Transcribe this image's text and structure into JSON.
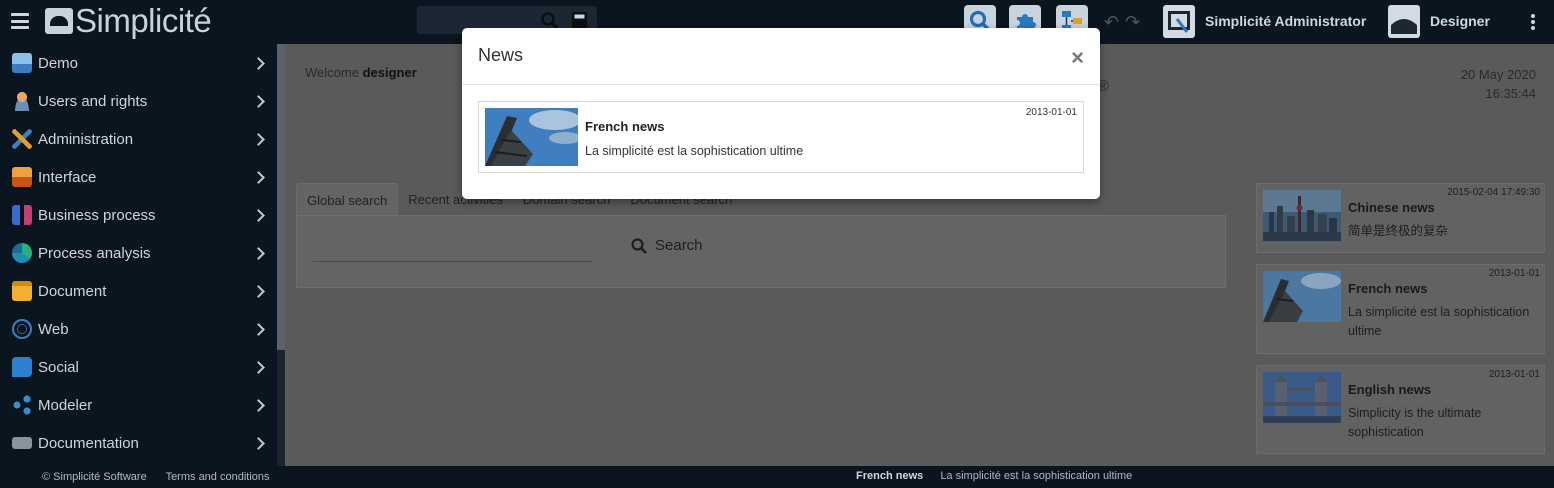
{
  "app": {
    "brand": "Simplicité"
  },
  "topbar": {
    "user_label": "Simplicité Administrator",
    "mode_label": "Designer",
    "icons": [
      "search-icon",
      "calculator-icon",
      "puzzle-icon",
      "diagram-icon",
      "undo-icon",
      "redo-icon",
      "more-vertical-icon"
    ],
    "accent_color": "#1e88c8"
  },
  "sidebar": {
    "items": [
      {
        "label": "Demo",
        "icon": "demo-icon",
        "color": "#3b7dc4"
      },
      {
        "label": "Users and rights",
        "icon": "user-icon",
        "color": "#c8864a"
      },
      {
        "label": "Administration",
        "icon": "tools-icon",
        "color": "#e0a030"
      },
      {
        "label": "Interface",
        "icon": "image-icon",
        "color": "#e06a20"
      },
      {
        "label": "Business process",
        "icon": "process-icon",
        "color": "#6a5acd"
      },
      {
        "label": "Process analysis",
        "icon": "chart-pie-icon",
        "color": "#20a0a0"
      },
      {
        "label": "Document",
        "icon": "folder-icon",
        "color": "#e0a020"
      },
      {
        "label": "Web",
        "icon": "globe-icon",
        "color": "#3a80c0"
      },
      {
        "label": "Social",
        "icon": "chat-icon",
        "color": "#2d7fd0"
      },
      {
        "label": "Modeler",
        "icon": "modeler-icon",
        "color": "#3a8cd0"
      },
      {
        "label": "Documentation",
        "icon": "markdown-icon",
        "color": "#9aa4ae"
      }
    ]
  },
  "main": {
    "welcome_prefix": "Welcome",
    "welcome_user": "designer",
    "date": "20 May 2020",
    "time": "16:35:44",
    "registered_mark": "®",
    "tabs": [
      {
        "label": "Global search"
      },
      {
        "label": "Recent activities"
      },
      {
        "label": "Domain search"
      },
      {
        "label": "Document search"
      }
    ],
    "search_button_label": "Search"
  },
  "news_feed": [
    {
      "title": "Chinese news",
      "date": "2015-02-04 17:49:30",
      "body": "简单是终极的复杂",
      "image": "shanghai-skyline"
    },
    {
      "title": "French news",
      "date": "2013-01-01",
      "body": "La simplicité est la sophistication ultime",
      "image": "eiffel-tower"
    },
    {
      "title": "English news",
      "date": "2013-01-01",
      "body": "Simplicity is the ultimate sophistication",
      "image": "tower-bridge"
    }
  ],
  "modal": {
    "title": "News",
    "close_label": "×",
    "item": {
      "title": "French news",
      "date": "2013-01-01",
      "body": "La simplicité est la sophistication ultime",
      "image": "eiffel-tower"
    }
  },
  "footer": {
    "copyright": "© Simplicité Software",
    "terms": "Terms and conditions",
    "ticker_title": "French news",
    "ticker_body": "La simplicité est la sophistication ultime"
  }
}
